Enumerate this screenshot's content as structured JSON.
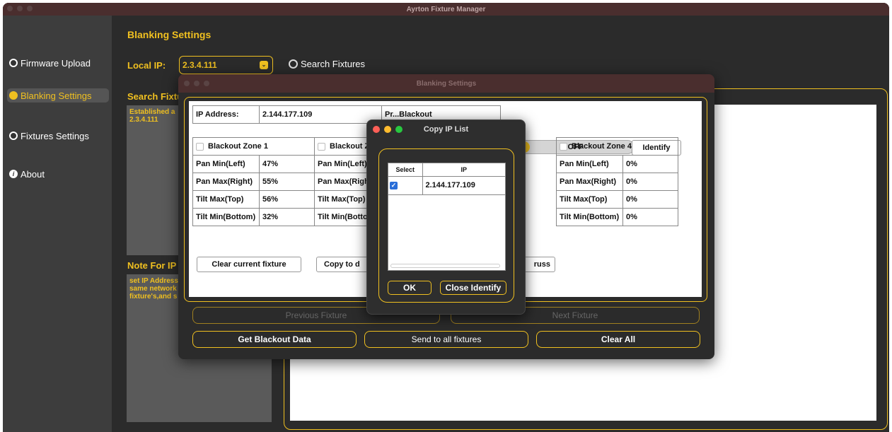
{
  "app": {
    "title": "Ayrton Fixture Manager"
  },
  "sidebar": {
    "items": [
      {
        "label": "Firmware Upload",
        "icon": "radio-icon"
      },
      {
        "label": "Blanking Settings",
        "icon": "blanking-icon",
        "active": true
      },
      {
        "label": "Fixtures Settings",
        "icon": "gear-icon"
      },
      {
        "label": "About",
        "icon": "info-icon"
      }
    ]
  },
  "main": {
    "title": "Blanking Settings",
    "local_ip_label": "Local IP:",
    "local_ip_value": "2.3.4.111",
    "search_label": "Search Fixtures",
    "search_section_label": "Search Fixtu",
    "search_log": "Established a\n2.3.4.111",
    "note_label": "Note For IP S",
    "note_text": "set IP Address\nsame network\nfixture's,and s"
  },
  "blanking_dialog": {
    "title": "Blanking Settings",
    "ip_address_label": "IP Address:",
    "ip_address_value": "2.144.177.109",
    "preset_label": "Pr...Blackout",
    "toggle_label": "OFF",
    "identify_label": "Identify",
    "zones": [
      {
        "label": "Blackout Zone 1",
        "pan_min": "47%",
        "pan_max": "55%",
        "tilt_max": "56%",
        "tilt_min": "32%"
      },
      {
        "label": "Blackout Z"
      },
      {
        "label": "Blackout Zone 4",
        "pan_min": "0%",
        "pan_max": "0%",
        "tilt_max": "0%",
        "tilt_min": "0%"
      }
    ],
    "row_labels": {
      "pan_min": "Pan Min(Left)",
      "pan_max": "Pan Max(Right)",
      "tilt_max": "Tilt Max(Top)",
      "tilt_min": "Tilt Min(Bottom)"
    },
    "truncated_row_labels": {
      "pan_min": "Pan Min(Left)",
      "pan_max": "Pan Max(Righ",
      "tilt_max": "Tilt Max(Top)",
      "tilt_min": "Tilt Min(Botto"
    },
    "clear_current_label": "Clear current fixture",
    "copy_to_label": "Copy to d",
    "truss_label": "russ",
    "previous_label": "Previous Fixture",
    "next_label": "Next Fixture",
    "get_blackout_label": "Get Blackout Data",
    "send_all_label": "Send to all fixtures",
    "clear_all_label": "Clear All"
  },
  "copy_ip_dialog": {
    "title": "Copy IP List",
    "col_select": "Select",
    "col_ip": "IP",
    "rows": [
      {
        "ip": "2.144.177.109",
        "checked": true
      }
    ],
    "ok_label": "OK",
    "close_identify_label": "Close Identify"
  },
  "colors": {
    "accent": "#f0c020",
    "background": "#2b2b2b",
    "sidebar": "#3d3d3d",
    "titlebar": "#4a2e2e"
  }
}
